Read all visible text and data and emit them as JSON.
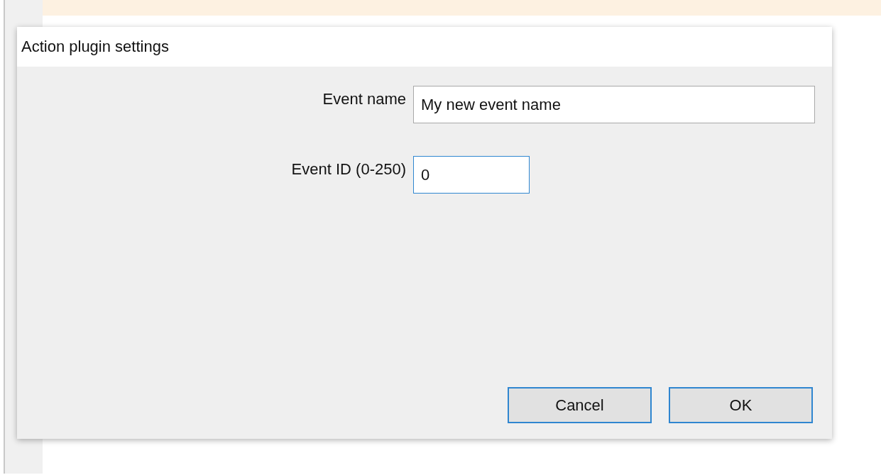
{
  "dialog": {
    "title": "Action plugin settings",
    "fields": [
      {
        "label": "Event name",
        "value": "My new event name",
        "focused": false
      },
      {
        "label": "Event ID (0-250)",
        "value": "0",
        "focused": true
      }
    ],
    "buttons": [
      {
        "label": "Cancel"
      },
      {
        "label": "OK"
      }
    ]
  }
}
